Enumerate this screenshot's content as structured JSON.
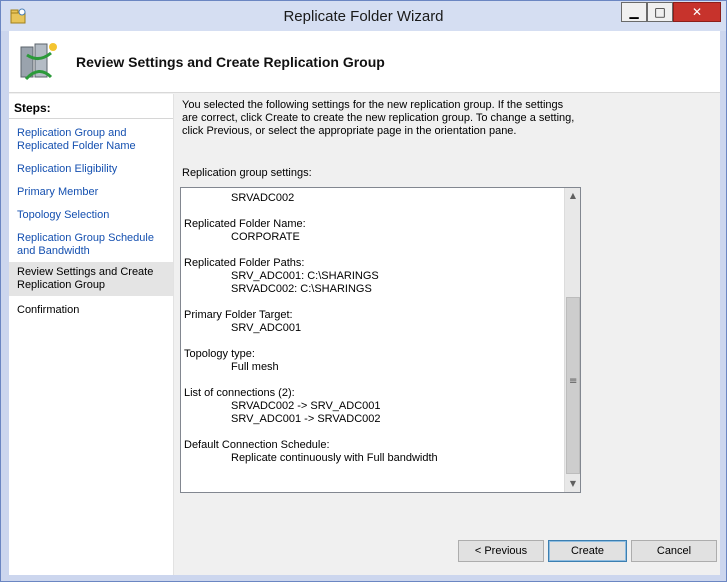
{
  "window": {
    "title": "Replicate Folder Wizard",
    "min_glyph": "▁",
    "max_glyph": "□",
    "close_glyph": "✕"
  },
  "header": {
    "title": "Review Settings and Create Replication Group"
  },
  "steps": {
    "label": "Steps:",
    "items": [
      {
        "label": "Replication Group and Replicated Folder Name",
        "state": "link"
      },
      {
        "label": "Replication Eligibility",
        "state": "link"
      },
      {
        "label": "Primary Member",
        "state": "link"
      },
      {
        "label": "Topology Selection",
        "state": "link"
      },
      {
        "label": "Replication Group Schedule and Bandwidth",
        "state": "link"
      },
      {
        "label": "Review Settings and Create Replication Group",
        "state": "current"
      },
      {
        "label": "Confirmation",
        "state": "plain"
      }
    ]
  },
  "main": {
    "instructions": "You selected the following settings for the new replication group. If the settings are correct, click Create to create the new replication group. To change a setting, click Previous, or select the appropriate page in the orientation pane.",
    "settings_label": "Replication group settings:",
    "settings": {
      "top_value": "SRVADC002",
      "folder_name_heading": "Replicated Folder Name:",
      "folder_name_value": "CORPORATE",
      "paths_heading": "Replicated Folder Paths:",
      "paths": [
        "SRV_ADC001: C:\\SHARINGS",
        "SRVADC002: C:\\SHARINGS"
      ],
      "primary_heading": "Primary Folder Target:",
      "primary_value": "SRV_ADC001",
      "topology_heading": "Topology type:",
      "topology_value": "Full mesh",
      "connections_heading": "List of connections (2):",
      "connections": [
        "SRVADC002 -> SRV_ADC001",
        "SRV_ADC001 -> SRVADC002"
      ],
      "schedule_heading": "Default Connection Schedule:",
      "schedule_value": "Replicate continuously with Full bandwidth"
    },
    "scrollbar": {
      "up_glyph": "▲",
      "down_glyph": "▼",
      "grip_glyph": "≡"
    }
  },
  "buttons": {
    "previous": "< Previous",
    "create": "Create",
    "cancel": "Cancel"
  },
  "colors": {
    "link": "#1550b0",
    "title_bar": "#d5def2",
    "close_button": "#c7332c"
  },
  "icons": {
    "app": "replication-wizard-icon",
    "header": "replication-servers-icon"
  }
}
